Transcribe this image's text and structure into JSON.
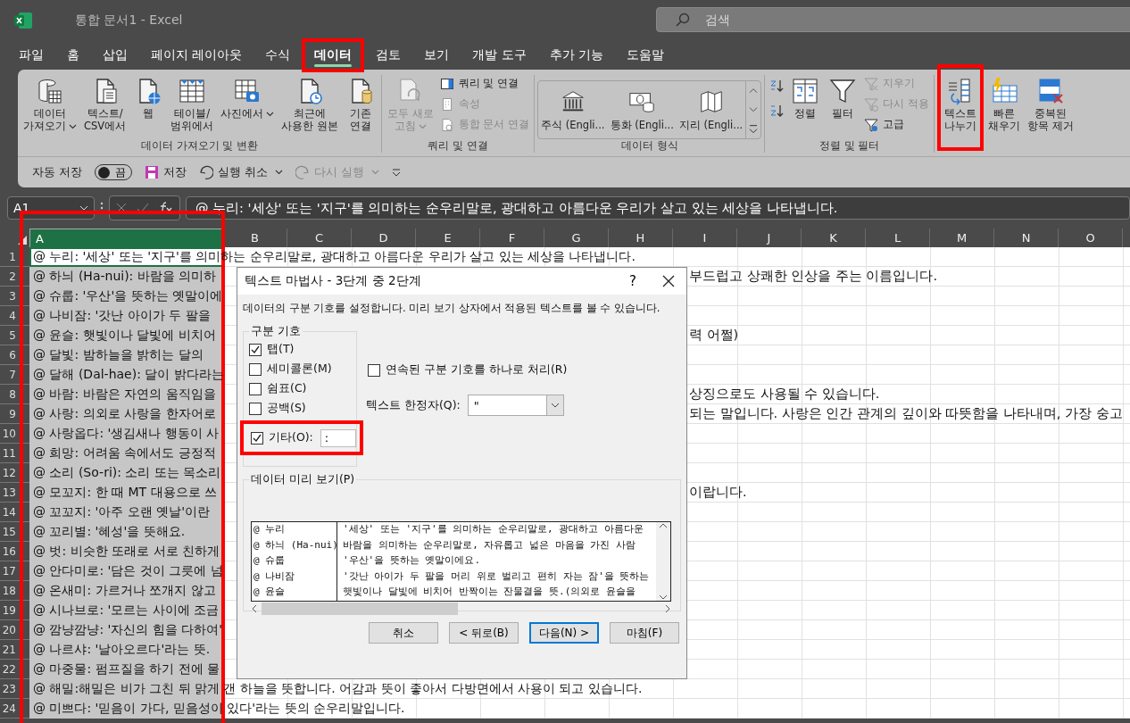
{
  "window": {
    "title": "통합 문서1  -  Excel"
  },
  "search": {
    "placeholder": "검색"
  },
  "tabs": [
    {
      "label": "파일",
      "selected": false
    },
    {
      "label": "홈",
      "selected": false
    },
    {
      "label": "삽입",
      "selected": false
    },
    {
      "label": "페이지 레이아웃",
      "selected": false
    },
    {
      "label": "수식",
      "selected": false
    },
    {
      "label": "데이터",
      "selected": true,
      "highlighted": true
    },
    {
      "label": "검토",
      "selected": false
    },
    {
      "label": "보기",
      "selected": false
    },
    {
      "label": "개발 도구",
      "selected": false
    },
    {
      "label": "추가 기능",
      "selected": false
    },
    {
      "label": "도움말",
      "selected": false
    }
  ],
  "ribbon": {
    "groups": [
      {
        "label": "데이터 가져오기 및 변환",
        "buttons": [
          {
            "kind": "large",
            "label": "데이터\n가져오기",
            "dropdown": true,
            "disabled": false
          },
          {
            "kind": "large",
            "label": "텍스트/\nCSV에서",
            "disabled": false
          },
          {
            "kind": "large",
            "label": "웹",
            "disabled": false
          },
          {
            "kind": "large",
            "label": "테이블/\n범위에서",
            "disabled": false
          },
          {
            "kind": "large",
            "label": "사진에서",
            "dropdown": true,
            "disabled": false
          },
          {
            "kind": "large",
            "label": "최근에\n사용한 원본",
            "disabled": false
          },
          {
            "kind": "large",
            "label": "기존\n연결",
            "disabled": false
          }
        ]
      },
      {
        "label": "쿼리 및 연결",
        "buttons": [
          {
            "kind": "large",
            "label": "모두 새로\n고침",
            "dropdown": true,
            "disabled": true
          },
          {
            "kind": "small",
            "label": "쿼리 및 연결",
            "disabled": false
          },
          {
            "kind": "small",
            "label": "속성",
            "disabled": true
          },
          {
            "kind": "small",
            "label": "통합 문서 연결",
            "disabled": true
          }
        ]
      },
      {
        "label": "데이터 형식",
        "buttons": [
          {
            "kind": "gallery",
            "items": [
              "주식 (Engli...",
              "통화 (Engli...",
              "지리 (Engli..."
            ]
          }
        ]
      },
      {
        "label": "정렬 및 필터",
        "buttons": [
          {
            "kind": "icon",
            "disabled": false
          },
          {
            "kind": "icon",
            "disabled": false
          },
          {
            "kind": "large",
            "label": "정렬",
            "disabled": false
          },
          {
            "kind": "large",
            "label": "필터",
            "disabled": false
          },
          {
            "kind": "small",
            "label": "지우기",
            "disabled": true
          },
          {
            "kind": "small",
            "label": "다시 적용",
            "disabled": true
          },
          {
            "kind": "small",
            "label": "고급",
            "disabled": false
          }
        ]
      },
      {
        "buttons": [
          {
            "kind": "large",
            "label": "텍스트\n나누기",
            "disabled": false,
            "highlighted": true
          },
          {
            "kind": "large",
            "label": "빠른\n채우기",
            "disabled": false
          },
          {
            "kind": "large",
            "label": "중복된\n항목 제거",
            "disabled": false
          }
        ]
      }
    ]
  },
  "quick_access": {
    "autosave_label": "자동 저장",
    "autosave_toggle": {
      "label": "끔",
      "on": false
    },
    "save": "저장",
    "undo": {
      "label": "실행 취소",
      "disabled": false
    },
    "redo": {
      "label": "다시 실행",
      "disabled": true
    }
  },
  "formula_bar": {
    "name_box": "A1",
    "formula": "@ 누리: '세상' 또는 '지구'를 의미하는 순우리말로, 광대하고 아름다운 우리가 살고 있는 세상을 나타냅니다."
  },
  "columns": [
    {
      "label": "A",
      "selected": true,
      "highlighted": true
    },
    {
      "label": "B",
      "selected": false
    },
    {
      "label": "C",
      "selected": false
    },
    {
      "label": "D",
      "selected": false
    },
    {
      "label": "E",
      "selected": false
    },
    {
      "label": "F",
      "selected": false
    },
    {
      "label": "G",
      "selected": false
    },
    {
      "label": "H",
      "selected": false
    },
    {
      "label": "I",
      "selected": false
    },
    {
      "label": "J",
      "selected": false
    },
    {
      "label": "K",
      "selected": false
    },
    {
      "label": "L",
      "selected": false
    },
    {
      "label": "M",
      "selected": false
    },
    {
      "label": "N",
      "selected": false
    },
    {
      "label": "O",
      "selected": false
    }
  ],
  "rows": [
    {
      "number": "1",
      "active": true,
      "text": "@ 누리: '세상' 또는 '지구'를 의미하는 순우리말로, 광대하고 아름다운 우리가 살고 있는 세상을 나타냅니다."
    },
    {
      "number": "2",
      "active": false,
      "text": "@ 하늬 (Ha-nui): 바람을 의미하",
      "overflow_text": "부드럽고 상쾌한 인상을 주는 이름입니다."
    },
    {
      "number": "3",
      "active": false,
      "text": "@ 슈룹: '우산'을 뜻하는 옛말이에"
    },
    {
      "number": "4",
      "active": false,
      "text": "@ 나비잠: '갓난 아이가 두 팔을"
    },
    {
      "number": "5",
      "active": false,
      "text": "@ 윤슬: 햇빛이나 달빛에 비치어",
      "overflow_text": "력 어쩔)"
    },
    {
      "number": "6",
      "active": false,
      "text": "@ 달빛: 밤하늘을 밝히는 달의"
    },
    {
      "number": "7",
      "active": false,
      "text": "@ 달해 (Dal-hae): 달이 밝다라는"
    },
    {
      "number": "8",
      "active": false,
      "text": "@ 바람: 바람은 자연의 움직임을",
      "overflow_text": "상징으로도 사용될 수 있습니다."
    },
    {
      "number": "9",
      "active": false,
      "text": "@ 사랑: 의외로 사랑을 한자어로",
      "overflow_text": "되는 말입니다. 사랑은 인간 관계의 깊이와 따뜻함을 나타내며, 가장 숭고"
    },
    {
      "number": "10",
      "active": false,
      "text": "@ 사랑옵다: '생김새나 행동이 사"
    },
    {
      "number": "11",
      "active": false,
      "text": "@ 희망: 어려움 속에서도 긍정적"
    },
    {
      "number": "12",
      "active": false,
      "text": "@ 소리 (So-ri): 소리 또는 목소리"
    },
    {
      "number": "13",
      "active": false,
      "text": "@ 모꼬지: 한 때 MT 대용으로 쓰",
      "overflow_text": "이랍니다."
    },
    {
      "number": "14",
      "active": false,
      "text": "@ 꼬꼬지: '아주 오랜 옛날'이란"
    },
    {
      "number": "15",
      "active": false,
      "text": "@ 꼬리별: '혜성'을 뜻해요."
    },
    {
      "number": "16",
      "active": false,
      "text": "@ 벗: 비슷한 또래로 서로 친하게"
    },
    {
      "number": "17",
      "active": false,
      "text": "@ 안다미로: '담은 것이 그릇에 넘"
    },
    {
      "number": "18",
      "active": false,
      "text": "@ 온새미: 가르거나 쪼개지 않고"
    },
    {
      "number": "19",
      "active": false,
      "text": "@ 시나브로: '모르는 사이에 조금"
    },
    {
      "number": "20",
      "active": false,
      "text": "@ 깜냥깜냥: '자신의 힘을 다하여'"
    },
    {
      "number": "21",
      "active": false,
      "text": "@ 나르샤: '날아오르다'라는 뜻."
    },
    {
      "number": "22",
      "active": false,
      "text": "@ 마중물: 펌프질을 하기 전에 물"
    },
    {
      "number": "23",
      "active": false,
      "text": "@ 해밀:해밀은 비가 그친 뒤 맑게 갠 하늘을 뜻합니다. 어감과 뜻이 좋아서 다방면에서 사용이 되고 있습니다."
    },
    {
      "number": "24",
      "active": false,
      "text": "@ 미쁘다: '믿음이 가다, 믿음성이 있다'라는 뜻의 순우리말입니다."
    }
  ],
  "dialog": {
    "title": "텍스트 마법사 - 3단계 중 2단계",
    "help": "?",
    "instruction": "데이터의 구분 기호를 설정합니다. 미리 보기 상자에서 적용된 텍스트를 볼 수 있습니다.",
    "delimiters_label": "구분 기호",
    "delimiters": [
      {
        "label": "탭(T)",
        "checked": true
      },
      {
        "label": "세미콜론(M)",
        "checked": false
      },
      {
        "label": "쉼표(C)",
        "checked": false
      },
      {
        "label": "공백(S)",
        "checked": false
      },
      {
        "label": "기타(O):",
        "checked": true,
        "value": ":",
        "highlighted": true
      }
    ],
    "consecutive": {
      "label": "연속된 구분 기호를 하나로 처리(R)",
      "checked": false
    },
    "qualifier": {
      "label": "텍스트 한정자(Q):",
      "value": "\""
    },
    "preview_label": "데이터 미리 보기(P)",
    "preview_rows": [
      [
        "@ 누리",
        "'세상' 또는 '지구'를 의미하는 순우리말로, 광대하고 아름다운"
      ],
      [
        "@ 하늬 (Ha-nui)",
        "바람을 의미하는 순우리말로, 자유롭고 넓은 마음을 가진 사람"
      ],
      [
        "@ 슈룹",
        "'우산'을 뜻하는 옛말이에요."
      ],
      [
        "@ 나비잠",
        "'갓난 아이가 두 팔을 머리 위로 벌리고 편히 자는 잠'을 뜻하는"
      ],
      [
        "@ 윤슬",
        "햇빛이나 달빛에 비치어 반짝이는 잔물결을 뜻.(의외로 윤슬을"
      ]
    ],
    "buttons": [
      {
        "label": "취소",
        "default": false
      },
      {
        "label": "< 뒤로(B)",
        "default": false
      },
      {
        "label": "다음(N) >",
        "default": true
      },
      {
        "label": "마침(F)",
        "default": false
      }
    ]
  }
}
